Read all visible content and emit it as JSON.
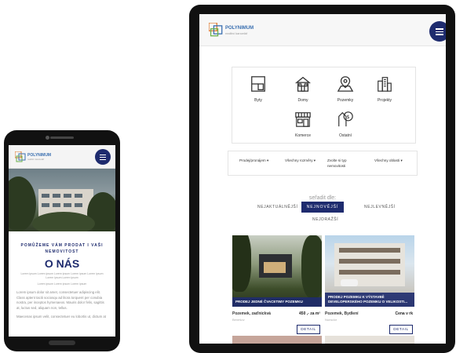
{
  "phone": {
    "header": {
      "logo_text": "POLYNIMUM",
      "logo_sub": "realitní kancelář"
    },
    "about": {
      "tagline": "POMŮŽEME VÁM PRODAT I VAŠI NEMOVITOST",
      "title": "O NÁS",
      "lorem_1": "Lorem ipsum Lorem ipsum Lorem ipsum Lorem ipsum Lorem ipsum Lorem ipsum Lorem ipsum",
      "lorem_2": "Lorem ipsum Lorem ipsum Lorem ipsum",
      "body": "Lorem ipsum dolor sit amet, consectetuer adipiscing elit. Class aptent taciti sociosqu ad litora torquent per conubia nostra, per inceptos hymenaeos. Mauris dolor felis, sagittis at, luctus sed, aliquam non, tellus.",
      "body_2": "Maecenas ipsum velit, consectetuer eu lobortis ut, dictum at"
    }
  },
  "tablet": {
    "header": {
      "logo_text": "POLYNIMUM",
      "logo_sub": "realitní kancelář"
    },
    "categories": [
      {
        "label": "Byty",
        "icon": "apartment-icon"
      },
      {
        "label": "Domy",
        "icon": "house-icon"
      },
      {
        "label": "Pozemky",
        "icon": "land-pin-icon"
      },
      {
        "label": "Projekty",
        "icon": "buildings-icon"
      },
      {
        "label": "Komerce",
        "icon": "store-icon"
      },
      {
        "label": "Ostatní",
        "icon": "price-tag-icon"
      }
    ],
    "filters": {
      "type": "Prodej/pronájem",
      "rooms": "Všechny rozměry",
      "kind_line1": "Zvolte si typ",
      "kind_line2": "nemovitosti",
      "region": "Všechny oblasti"
    },
    "sort": {
      "title": "seřadit dle:",
      "options": [
        "NEJAKTUÁLNĚJŠÍ",
        "NEJNOVĚJŠÍ",
        "NEJLEVNĚJŠÍ",
        "NEJDRAŽŠÍ"
      ],
      "active": "NEJNOVĚJŠÍ"
    },
    "listings": [
      {
        "caption": "PRODEJ JEDNÉ ČVACETIMY POZEMKU",
        "type": "Pozemek, zaďnickvá",
        "location": "Benešov",
        "price": "450 ,- za m²",
        "button": "DETAIL"
      },
      {
        "caption": "PRODEJ POZEMKU K VÝSTAVBĚ DEVELOPERSKÉHO POZEMKU O VELIKOSTI...",
        "type": "Pozemek, Bydlení",
        "location": "Nunsdor",
        "price": "Cena v rk",
        "button": "DETAIL"
      }
    ]
  },
  "colors": {
    "brand": "#1e2b6e",
    "muted": "#9a9a9a"
  }
}
